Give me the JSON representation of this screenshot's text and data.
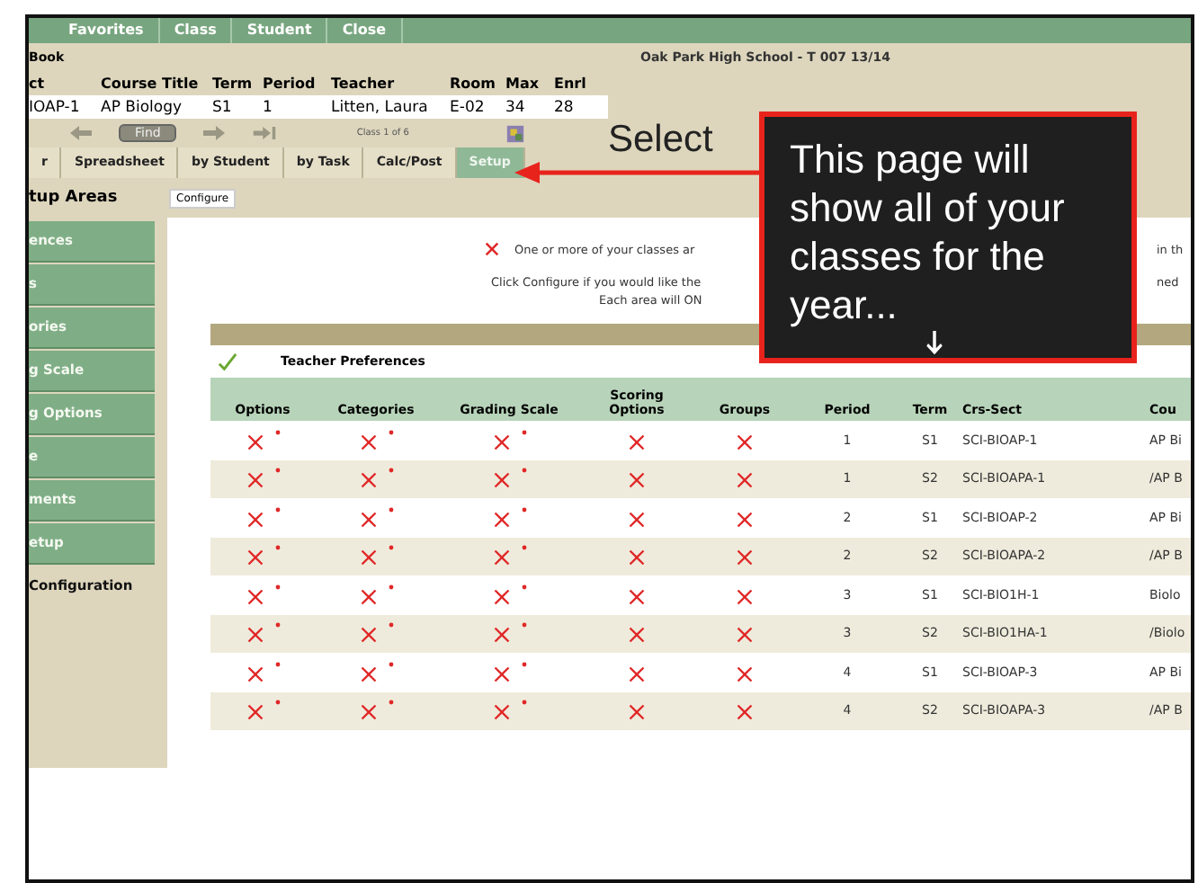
{
  "nav": [
    {
      "label": "Favorites"
    },
    {
      "label": "Class"
    },
    {
      "label": "Student"
    },
    {
      "label": "Close"
    }
  ],
  "page_title": "Book",
  "school": "Oak Park High School - T 007 13/14",
  "class_header": [
    "ct",
    "Course Title",
    "Term",
    "Period",
    "Teacher",
    "Room",
    "Max",
    "Enrl"
  ],
  "class_row": [
    "IOAP-1",
    "AP Biology",
    "S1",
    "1",
    "Litten, Laura",
    "E-02",
    "34",
    "28"
  ],
  "pager": {
    "find": "Find",
    "position": "Class 1 of 6"
  },
  "tabs": [
    {
      "label": "r",
      "selected": false
    },
    {
      "label": "Spreadsheet",
      "selected": false
    },
    {
      "label": "by Student",
      "selected": false
    },
    {
      "label": "by Task",
      "selected": false
    },
    {
      "label": "Calc/Post",
      "selected": false
    },
    {
      "label": "Setup",
      "selected": true
    }
  ],
  "section_title": "tup Areas",
  "configure_button": "Configure",
  "sidebar": [
    {
      "label": "ences",
      "selected": false
    },
    {
      "label": "s",
      "selected": false
    },
    {
      "label": "ories",
      "selected": false
    },
    {
      "label": "g Scale",
      "selected": false
    },
    {
      "label": "g Options",
      "selected": false
    },
    {
      "label": "e",
      "selected": false
    },
    {
      "label": "ments",
      "selected": false
    },
    {
      "label": "etup",
      "selected": false
    },
    {
      "label": "Configuration",
      "selected": true
    }
  ],
  "messages": [
    {
      "left": "One or more of your classes ar",
      "right": "in th",
      "warn": true
    },
    {
      "left": "Click Configure if you would like the",
      "right": "ned",
      "warn": false
    },
    {
      "left": "Each area will ON",
      "warn": false
    }
  ],
  "teacher_preferences": {
    "label": "Teacher Preferences",
    "ok": true
  },
  "table": {
    "columns": [
      "Options",
      "Categories",
      "Grading Scale",
      "Scoring Options",
      "Groups",
      "Period",
      "Term",
      "Crs-Sect",
      "Cou"
    ],
    "rows": [
      {
        "checks": [
          {
            "ok": false,
            "required": true
          },
          {
            "ok": false,
            "required": true
          },
          {
            "ok": false,
            "required": true
          },
          {
            "ok": false,
            "required": false
          },
          {
            "ok": false,
            "required": false
          }
        ],
        "period": "1",
        "term": "S1",
        "section": "SCI-BIOAP-1",
        "course": "AP Bi"
      },
      {
        "checks": [
          {
            "ok": false,
            "required": true
          },
          {
            "ok": false,
            "required": true
          },
          {
            "ok": false,
            "required": true
          },
          {
            "ok": false,
            "required": false
          },
          {
            "ok": false,
            "required": false
          }
        ],
        "period": "1",
        "term": "S2",
        "section": "SCI-BIOAPA-1",
        "course": "/AP B"
      },
      {
        "checks": [
          {
            "ok": false,
            "required": true
          },
          {
            "ok": false,
            "required": true
          },
          {
            "ok": false,
            "required": true
          },
          {
            "ok": false,
            "required": false
          },
          {
            "ok": false,
            "required": false
          }
        ],
        "period": "2",
        "term": "S1",
        "section": "SCI-BIOAP-2",
        "course": "AP Bi"
      },
      {
        "checks": [
          {
            "ok": false,
            "required": true
          },
          {
            "ok": false,
            "required": true
          },
          {
            "ok": false,
            "required": true
          },
          {
            "ok": false,
            "required": false
          },
          {
            "ok": false,
            "required": false
          }
        ],
        "period": "2",
        "term": "S2",
        "section": "SCI-BIOAPA-2",
        "course": "/AP B"
      },
      {
        "checks": [
          {
            "ok": false,
            "required": true
          },
          {
            "ok": false,
            "required": true
          },
          {
            "ok": false,
            "required": true
          },
          {
            "ok": false,
            "required": false
          },
          {
            "ok": false,
            "required": false
          }
        ],
        "period": "3",
        "term": "S1",
        "section": "SCI-BIO1H-1",
        "course": "Biolo"
      },
      {
        "checks": [
          {
            "ok": false,
            "required": true
          },
          {
            "ok": false,
            "required": true
          },
          {
            "ok": false,
            "required": true
          },
          {
            "ok": false,
            "required": false
          },
          {
            "ok": false,
            "required": false
          }
        ],
        "period": "3",
        "term": "S2",
        "section": "SCI-BIO1HA-1",
        "course": "/Biolo"
      },
      {
        "checks": [
          {
            "ok": false,
            "required": true
          },
          {
            "ok": false,
            "required": true
          },
          {
            "ok": false,
            "required": true
          },
          {
            "ok": false,
            "required": false
          },
          {
            "ok": false,
            "required": false
          }
        ],
        "period": "4",
        "term": "S1",
        "section": "SCI-BIOAP-3",
        "course": "AP Bi"
      },
      {
        "checks": [
          {
            "ok": false,
            "required": true
          },
          {
            "ok": false,
            "required": true
          },
          {
            "ok": false,
            "required": true
          },
          {
            "ok": false,
            "required": false
          },
          {
            "ok": false,
            "required": false
          }
        ],
        "period": "4",
        "term": "S2",
        "section": "SCI-BIOAPA-3",
        "course": "/AP B"
      }
    ]
  },
  "annotation": {
    "label": "Select",
    "callout": "This page will show all of your classes for the year..."
  }
}
